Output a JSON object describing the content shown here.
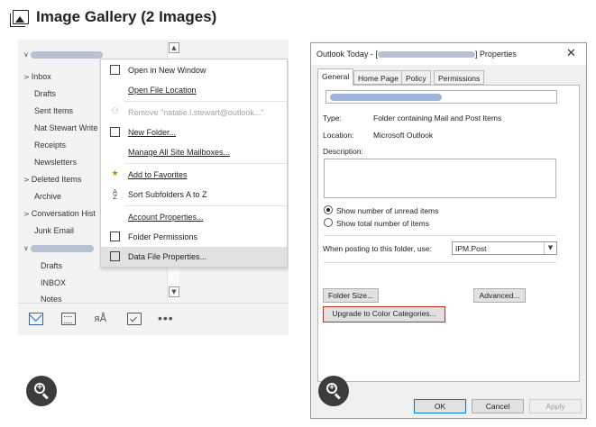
{
  "gallery": {
    "title": "Image Gallery (2 Images)"
  },
  "left_screenshot": {
    "folders": [
      {
        "label": "Inbox",
        "caret": ">"
      },
      {
        "label": "Drafts",
        "caret": ""
      },
      {
        "label": "Sent Items",
        "caret": ""
      },
      {
        "label": "Nat Stewart Write",
        "caret": ""
      },
      {
        "label": "Receipts",
        "caret": ""
      },
      {
        "label": "Newsletters",
        "caret": ""
      },
      {
        "label": "Deleted Items",
        "caret": ">"
      },
      {
        "label": "Archive",
        "caret": ""
      },
      {
        "label": "Conversation Hist",
        "caret": ">"
      },
      {
        "label": "Junk Email",
        "caret": ""
      },
      {
        "label": "Drafts",
        "caret": ""
      },
      {
        "label": "INBOX",
        "caret": ""
      },
      {
        "label": "Notes",
        "caret": ""
      }
    ],
    "context_menu": {
      "items": [
        {
          "label": "Open in New Window",
          "icon": "new-window-icon",
          "disabled": false
        },
        {
          "label": "Open File Location",
          "icon": "",
          "disabled": false
        },
        {
          "label": "Remove \"natalie.l.stewart@outlook...\"",
          "icon": "remove-account-icon",
          "disabled": true
        },
        {
          "label": "New Folder...",
          "icon": "new-folder-icon",
          "disabled": false
        },
        {
          "label": "Manage All Site Mailboxes...",
          "icon": "",
          "disabled": false
        },
        {
          "label": "Add to Favorites",
          "icon": "favorites-star-icon",
          "disabled": false
        },
        {
          "label": "Sort Subfolders A to Z",
          "icon": "sort-az-icon",
          "disabled": false
        },
        {
          "label": "Account Properties...",
          "icon": "",
          "disabled": false
        },
        {
          "label": "Folder Permissions",
          "icon": "folder-permissions-icon",
          "disabled": false
        },
        {
          "label": "Data File Properties...",
          "icon": "data-file-icon",
          "disabled": false,
          "highlighted": true
        }
      ]
    },
    "nav_icons": [
      "mail-icon",
      "calendar-icon",
      "people-icon",
      "tasks-icon",
      "more-icon"
    ]
  },
  "dialog": {
    "title_prefix": "Outlook Today - [",
    "title_suffix": "] Properties",
    "close": "✕",
    "tabs": [
      "General",
      "Home Page",
      "Policy",
      "Permissions"
    ],
    "type_label": "Type:",
    "type_value": "Folder containing Mail and Post Items",
    "location_label": "Location:",
    "location_value": "Microsoft Outlook",
    "description_label": "Description:",
    "radio_unread": "Show number of unread items",
    "radio_total": "Show total number of items",
    "posting_label": "When posting to this folder, use:",
    "posting_value": "IPM.Post",
    "folder_size_button": "Folder Size...",
    "advanced_button": "Advanced...",
    "upgrade_button": "Upgrade to Color Categories...",
    "ok_button": "OK",
    "cancel_button": "Cancel",
    "apply_button": "Apply",
    "highlight_color": "#c62828"
  }
}
